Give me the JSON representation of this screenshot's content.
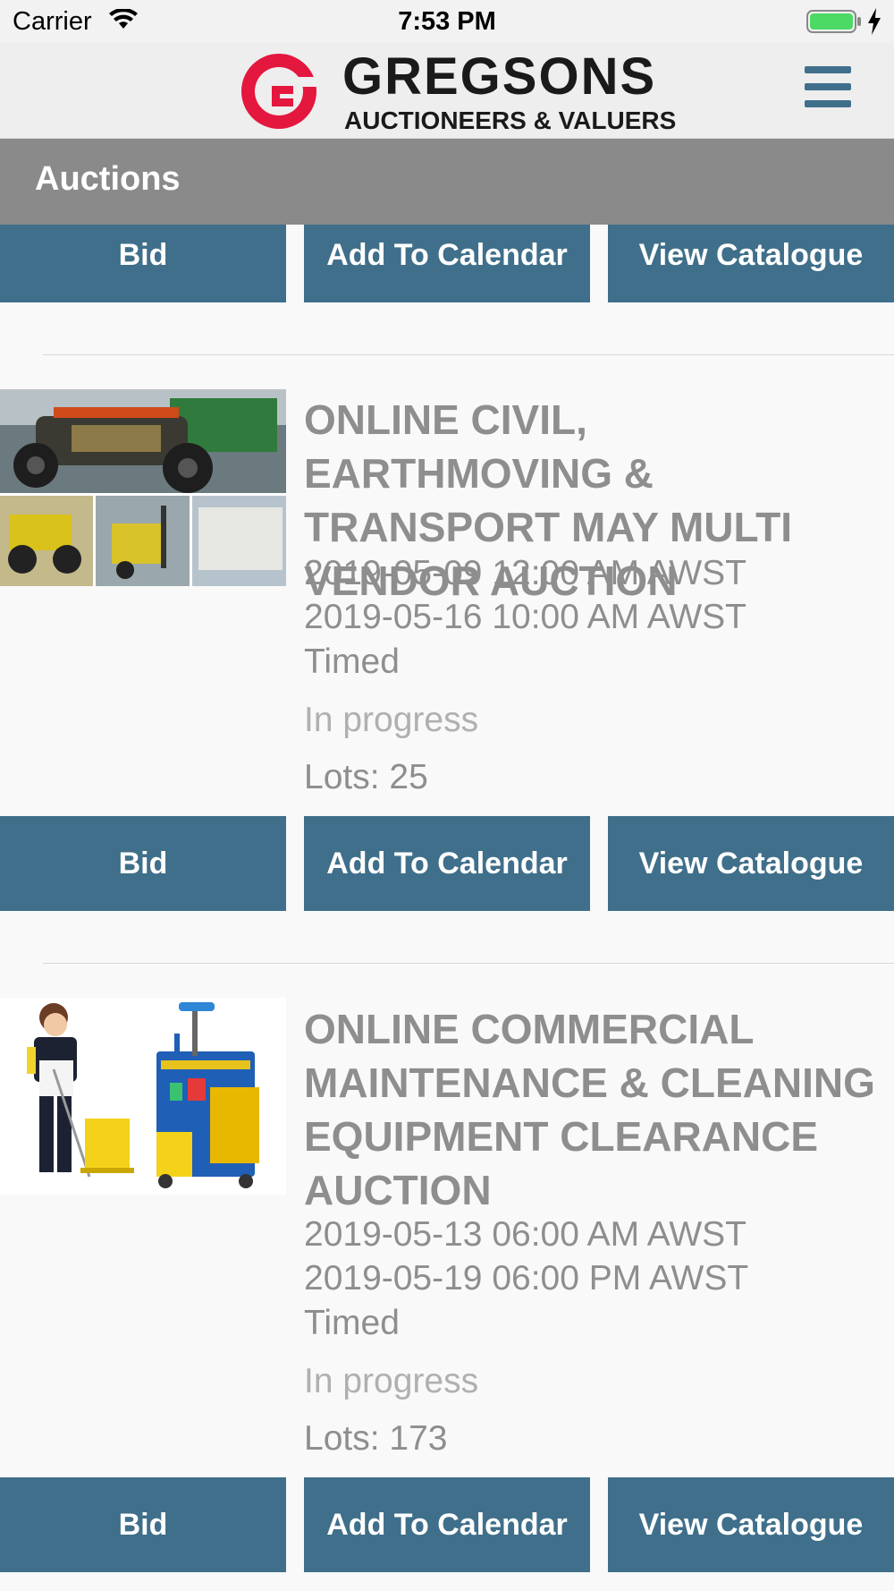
{
  "status_bar": {
    "carrier": "Carrier",
    "time": "7:53 PM",
    "battery_color": "#4cd964"
  },
  "header": {
    "logo_name": "GREGSONS",
    "logo_tagline": "AUCTIONEERS & VALUERS",
    "logo_color": "#e4173e",
    "accent_color": "#3f6f8a"
  },
  "page": {
    "title": "Auctions"
  },
  "buttons": {
    "bid": "Bid",
    "add_to_calendar": "Add To Calendar",
    "view_catalogue": "View Catalogue"
  },
  "auctions": [
    {
      "title": "ONLINE CIVIL, EARTHMOVING & TRANSPORT MAY MULTI VENDOR AUCTION",
      "start": "2019-05-09 12:00 AM AWST",
      "end": "2019-05-16 10:00 AM AWST",
      "type": "Timed",
      "status": "In progress",
      "lots": "Lots: 25",
      "image": "machinery-collage"
    },
    {
      "title": "ONLINE COMMERCIAL MAINTENANCE & CLEANING EQUIPMENT CLEARANCE AUCTION",
      "start": "2019-05-13 06:00 AM AWST",
      "end": "2019-05-19 06:00 PM AWST",
      "type": "Timed",
      "status": "In progress",
      "lots": "Lots: 173",
      "image": "cleaning-equipment"
    }
  ]
}
